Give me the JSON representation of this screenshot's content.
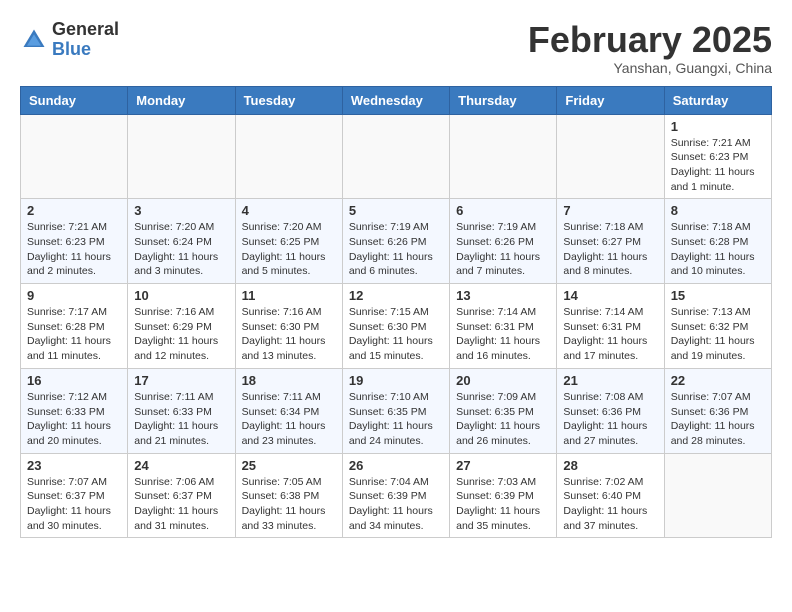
{
  "header": {
    "logo_general": "General",
    "logo_blue": "Blue",
    "month_title": "February 2025",
    "subtitle": "Yanshan, Guangxi, China"
  },
  "weekdays": [
    "Sunday",
    "Monday",
    "Tuesday",
    "Wednesday",
    "Thursday",
    "Friday",
    "Saturday"
  ],
  "weeks": [
    [
      {
        "day": "",
        "info": ""
      },
      {
        "day": "",
        "info": ""
      },
      {
        "day": "",
        "info": ""
      },
      {
        "day": "",
        "info": ""
      },
      {
        "day": "",
        "info": ""
      },
      {
        "day": "",
        "info": ""
      },
      {
        "day": "1",
        "info": "Sunrise: 7:21 AM\nSunset: 6:23 PM\nDaylight: 11 hours\nand 1 minute."
      }
    ],
    [
      {
        "day": "2",
        "info": "Sunrise: 7:21 AM\nSunset: 6:23 PM\nDaylight: 11 hours\nand 2 minutes."
      },
      {
        "day": "3",
        "info": "Sunrise: 7:20 AM\nSunset: 6:24 PM\nDaylight: 11 hours\nand 3 minutes."
      },
      {
        "day": "4",
        "info": "Sunrise: 7:20 AM\nSunset: 6:25 PM\nDaylight: 11 hours\nand 5 minutes."
      },
      {
        "day": "5",
        "info": "Sunrise: 7:19 AM\nSunset: 6:26 PM\nDaylight: 11 hours\nand 6 minutes."
      },
      {
        "day": "6",
        "info": "Sunrise: 7:19 AM\nSunset: 6:26 PM\nDaylight: 11 hours\nand 7 minutes."
      },
      {
        "day": "7",
        "info": "Sunrise: 7:18 AM\nSunset: 6:27 PM\nDaylight: 11 hours\nand 8 minutes."
      },
      {
        "day": "8",
        "info": "Sunrise: 7:18 AM\nSunset: 6:28 PM\nDaylight: 11 hours\nand 10 minutes."
      }
    ],
    [
      {
        "day": "9",
        "info": "Sunrise: 7:17 AM\nSunset: 6:28 PM\nDaylight: 11 hours\nand 11 minutes."
      },
      {
        "day": "10",
        "info": "Sunrise: 7:16 AM\nSunset: 6:29 PM\nDaylight: 11 hours\nand 12 minutes."
      },
      {
        "day": "11",
        "info": "Sunrise: 7:16 AM\nSunset: 6:30 PM\nDaylight: 11 hours\nand 13 minutes."
      },
      {
        "day": "12",
        "info": "Sunrise: 7:15 AM\nSunset: 6:30 PM\nDaylight: 11 hours\nand 15 minutes."
      },
      {
        "day": "13",
        "info": "Sunrise: 7:14 AM\nSunset: 6:31 PM\nDaylight: 11 hours\nand 16 minutes."
      },
      {
        "day": "14",
        "info": "Sunrise: 7:14 AM\nSunset: 6:31 PM\nDaylight: 11 hours\nand 17 minutes."
      },
      {
        "day": "15",
        "info": "Sunrise: 7:13 AM\nSunset: 6:32 PM\nDaylight: 11 hours\nand 19 minutes."
      }
    ],
    [
      {
        "day": "16",
        "info": "Sunrise: 7:12 AM\nSunset: 6:33 PM\nDaylight: 11 hours\nand 20 minutes."
      },
      {
        "day": "17",
        "info": "Sunrise: 7:11 AM\nSunset: 6:33 PM\nDaylight: 11 hours\nand 21 minutes."
      },
      {
        "day": "18",
        "info": "Sunrise: 7:11 AM\nSunset: 6:34 PM\nDaylight: 11 hours\nand 23 minutes."
      },
      {
        "day": "19",
        "info": "Sunrise: 7:10 AM\nSunset: 6:35 PM\nDaylight: 11 hours\nand 24 minutes."
      },
      {
        "day": "20",
        "info": "Sunrise: 7:09 AM\nSunset: 6:35 PM\nDaylight: 11 hours\nand 26 minutes."
      },
      {
        "day": "21",
        "info": "Sunrise: 7:08 AM\nSunset: 6:36 PM\nDaylight: 11 hours\nand 27 minutes."
      },
      {
        "day": "22",
        "info": "Sunrise: 7:07 AM\nSunset: 6:36 PM\nDaylight: 11 hours\nand 28 minutes."
      }
    ],
    [
      {
        "day": "23",
        "info": "Sunrise: 7:07 AM\nSunset: 6:37 PM\nDaylight: 11 hours\nand 30 minutes."
      },
      {
        "day": "24",
        "info": "Sunrise: 7:06 AM\nSunset: 6:37 PM\nDaylight: 11 hours\nand 31 minutes."
      },
      {
        "day": "25",
        "info": "Sunrise: 7:05 AM\nSunset: 6:38 PM\nDaylight: 11 hours\nand 33 minutes."
      },
      {
        "day": "26",
        "info": "Sunrise: 7:04 AM\nSunset: 6:39 PM\nDaylight: 11 hours\nand 34 minutes."
      },
      {
        "day": "27",
        "info": "Sunrise: 7:03 AM\nSunset: 6:39 PM\nDaylight: 11 hours\nand 35 minutes."
      },
      {
        "day": "28",
        "info": "Sunrise: 7:02 AM\nSunset: 6:40 PM\nDaylight: 11 hours\nand 37 minutes."
      },
      {
        "day": "",
        "info": ""
      }
    ]
  ]
}
